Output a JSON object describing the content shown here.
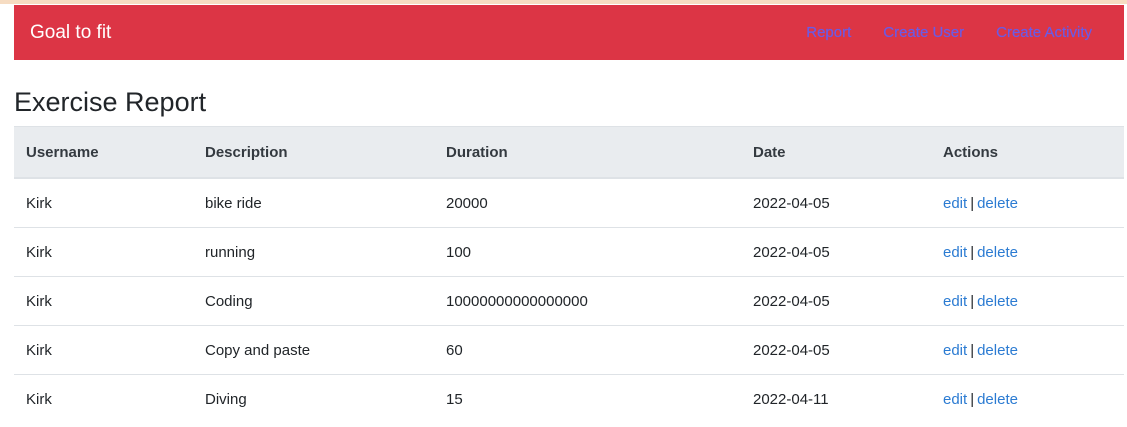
{
  "navbar": {
    "brand": "Goal to fit",
    "links": [
      "Report",
      "Create User",
      "Create Activity"
    ]
  },
  "page": {
    "title": "Exercise Report"
  },
  "table": {
    "headers": [
      "Username",
      "Description",
      "Duration",
      "Date",
      "Actions"
    ],
    "rows": [
      {
        "username": "Kirk",
        "description": "bike ride",
        "duration": "20000",
        "date": "2022-04-05"
      },
      {
        "username": "Kirk",
        "description": "running",
        "duration": "100",
        "date": "2022-04-05"
      },
      {
        "username": "Kirk",
        "description": "Coding",
        "duration": "10000000000000000",
        "date": "2022-04-05"
      },
      {
        "username": "Kirk",
        "description": "Copy and paste",
        "duration": "60",
        "date": "2022-04-05"
      },
      {
        "username": "Kirk",
        "description": "Diving",
        "duration": "15",
        "date": "2022-04-11"
      }
    ],
    "actions": {
      "edit": "edit",
      "separator": "|",
      "delete": "delete"
    }
  },
  "colors": {
    "navbar_bg": "#dc3545",
    "nav_link": "#6a5be6",
    "action_link": "#2b7bd2",
    "header_bg": "#e9ecef"
  }
}
